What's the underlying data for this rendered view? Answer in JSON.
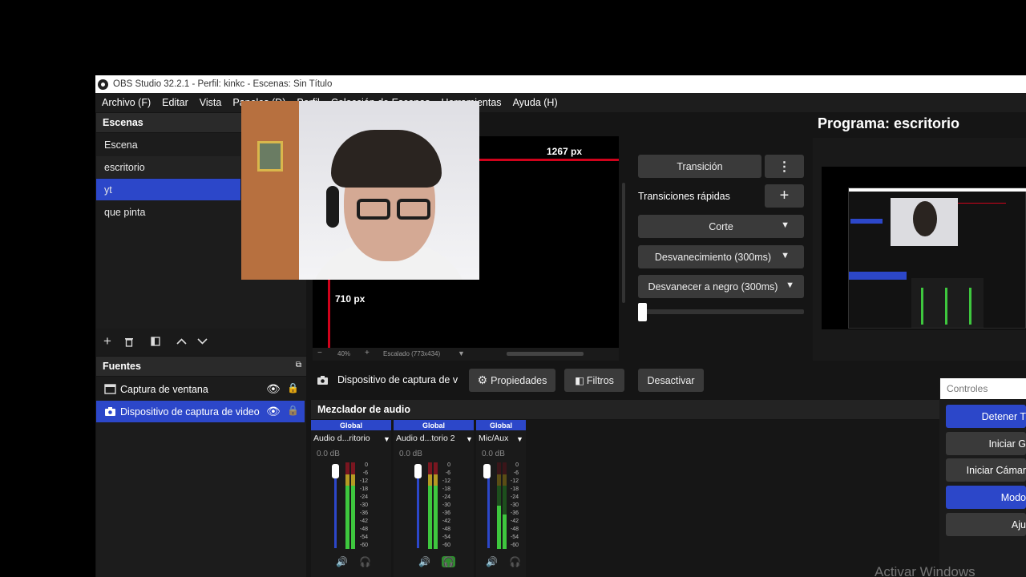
{
  "titlebar": {
    "title": "OBS Studio 32.2.1 - Perfil: kinkc - Escenas: Sin Título"
  },
  "menu": [
    "Archivo (F)",
    "Editar",
    "Vista",
    "Paneles (D)",
    "Perfil",
    "Colección de Escenas",
    "Herramientas",
    "Ayuda (H)"
  ],
  "scenes": {
    "title": "Escenas",
    "items": [
      "Escena",
      "escritorio",
      "yt",
      "que pinta"
    ],
    "selected": 2
  },
  "preview": {
    "width_label": "1267 px",
    "height_label": "710 px",
    "zoom": "40%",
    "scale_label": "Escalado (773x434)"
  },
  "transitions": {
    "transition_btn": "Transición",
    "quick_label": "Transiciones rápidas",
    "items": [
      "Corte",
      "Desvanecimiento (300ms)",
      "Desvanecer a negro (300ms)"
    ]
  },
  "program": {
    "title": "Programa: escritorio"
  },
  "sources": {
    "title": "Fuentes",
    "items": [
      "Captura de ventana",
      "Dispositivo de captura de video"
    ],
    "selected": 1
  },
  "source_toolbar": {
    "device_label": "Dispositivo de captura de v",
    "properties": "Propiedades",
    "filters": "Filtros",
    "deactivate": "Desactivar"
  },
  "mixer": {
    "title": "Mezclador de audio",
    "channels": [
      {
        "group": "Global",
        "name": "Audio d...ritorio",
        "db": "0.0 dB"
      },
      {
        "group": "Global",
        "name": "Audio d...torio 2",
        "db": "0.0 dB"
      },
      {
        "group": "Global",
        "name": "Mic/Aux",
        "db": "0.0 dB"
      }
    ],
    "scale": [
      "0",
      "-6",
      "-12",
      "-18",
      "-24",
      "-30",
      "-36",
      "-42",
      "-48",
      "-54",
      "-60"
    ]
  },
  "controls": {
    "title": "Controles",
    "buttons": [
      "Detener T",
      "Iniciar G",
      "Iniciar Cámar",
      "Modo",
      "Aju"
    ]
  },
  "watermark": "Activar Windows",
  "colors": {
    "accent": "#2c47c9",
    "red_guide": "#d0021b"
  }
}
